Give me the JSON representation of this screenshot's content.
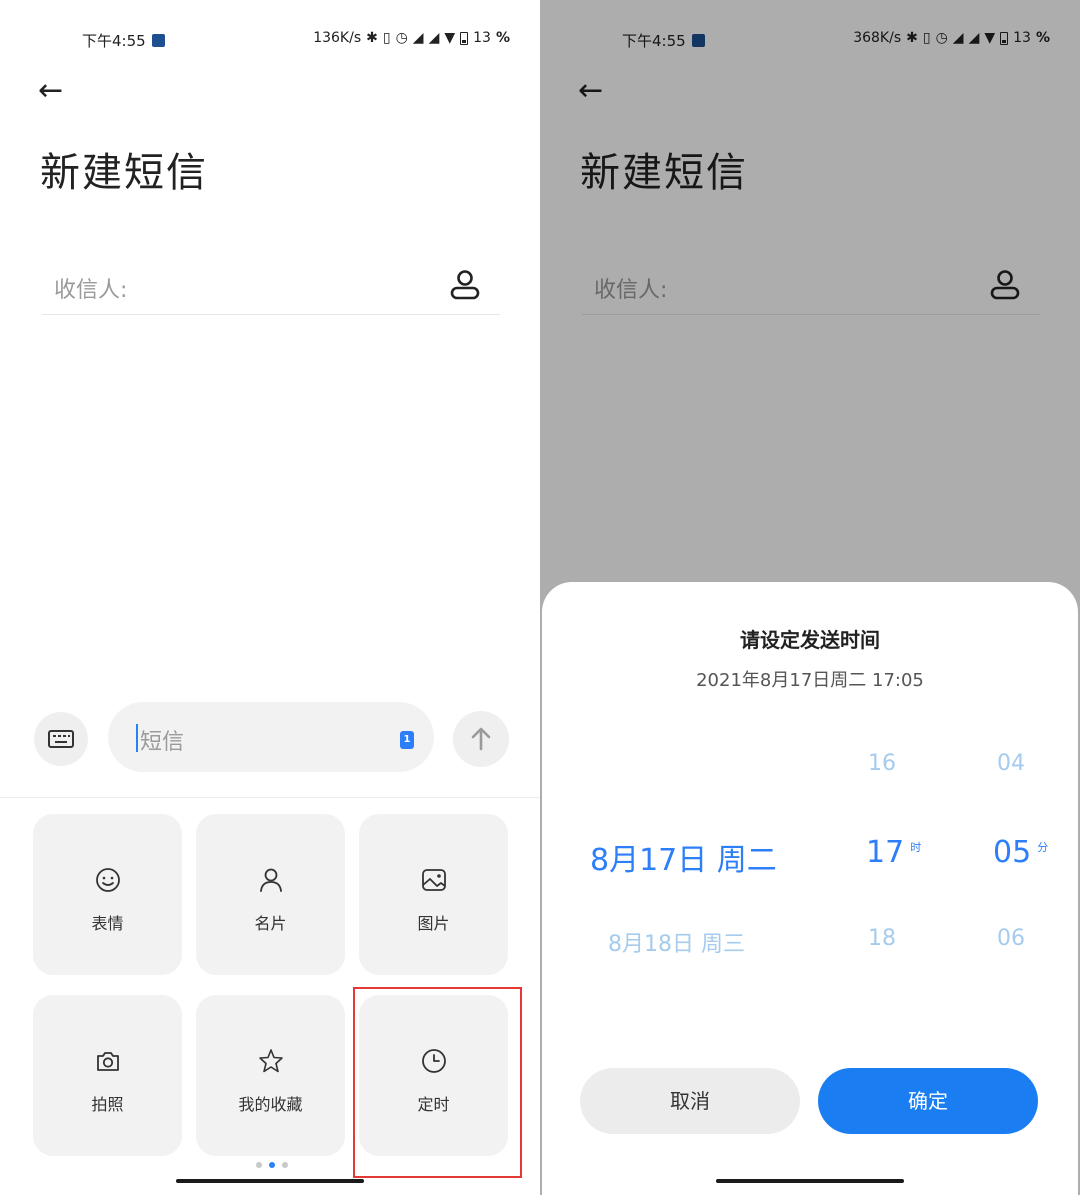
{
  "left": {
    "status": {
      "time": "下午4:55",
      "speed": "136K/s",
      "battery": "13",
      "percent": "%"
    },
    "title": "新建短信",
    "recipient_label": "收信人:",
    "message_placeholder": "短信",
    "sim_badge": "1",
    "tiles": [
      {
        "label": "表情",
        "icon": "smiley-icon"
      },
      {
        "label": "名片",
        "icon": "person-icon"
      },
      {
        "label": "图片",
        "icon": "picture-icon"
      },
      {
        "label": "拍照",
        "icon": "camera-icon"
      },
      {
        "label": "我的收藏",
        "icon": "star-icon"
      },
      {
        "label": "定时",
        "icon": "clock-icon"
      }
    ],
    "highlight_color": "#e53935"
  },
  "right": {
    "status": {
      "time": "下午4:55",
      "speed": "368K/s",
      "battery": "13",
      "percent": "%"
    },
    "title": "新建短信",
    "recipient_label": "收信人:",
    "sheet": {
      "title": "请设定发送时间",
      "subtitle": "2021年8月17日周二 17:05",
      "date_selected": "8月17日 周二",
      "date_next": "8月18日 周三",
      "hour_prev": "16",
      "hour_selected": "17",
      "hour_next": "18",
      "hour_unit": "时",
      "minute_prev": "04",
      "minute_selected": "05",
      "minute_next": "06",
      "minute_unit": "分",
      "cancel": "取消",
      "confirm": "确定"
    },
    "accent_color": "#1a7df2"
  }
}
